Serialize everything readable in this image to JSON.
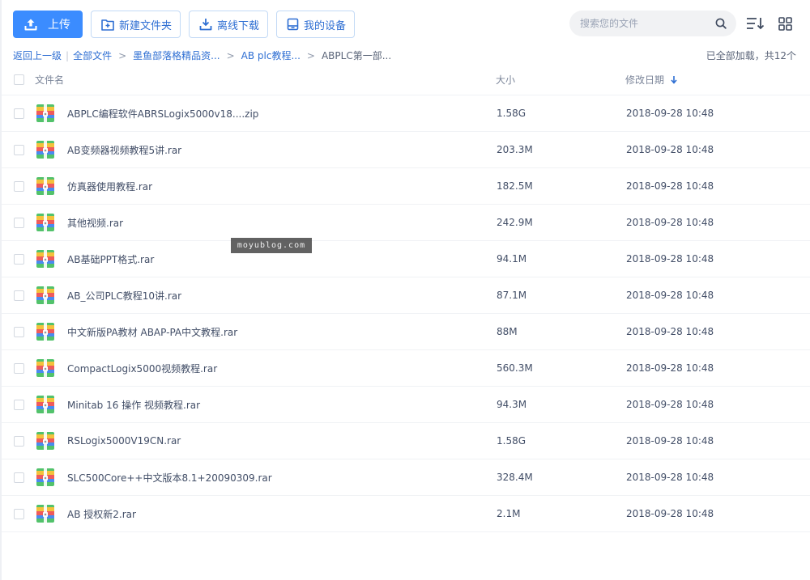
{
  "toolbar": {
    "upload_label": "上传",
    "new_folder_label": "新建文件夹",
    "offline_download_label": "离线下载",
    "my_devices_label": "我的设备"
  },
  "search": {
    "placeholder": "搜索您的文件"
  },
  "breadcrumb": {
    "back": "返回上一级",
    "all_files": "全部文件",
    "level1": "墨鱼部落格精品资...",
    "level2": "AB plc教程...",
    "current": "ABPLC第一部..."
  },
  "load_status": "已全部加载，共12个",
  "columns": {
    "name": "文件名",
    "size": "大小",
    "date": "修改日期"
  },
  "files": [
    {
      "name": "ABPLC编程软件ABRSLogix5000v18....zip",
      "size": "1.58G",
      "date": "2018-09-28 10:48"
    },
    {
      "name": "AB变频器视频教程5讲.rar",
      "size": "203.3M",
      "date": "2018-09-28 10:48"
    },
    {
      "name": "仿真器使用教程.rar",
      "size": "182.5M",
      "date": "2018-09-28 10:48"
    },
    {
      "name": "其他视频.rar",
      "size": "242.9M",
      "date": "2018-09-28 10:48"
    },
    {
      "name": "AB基础PPT格式.rar",
      "size": "94.1M",
      "date": "2018-09-28 10:48"
    },
    {
      "name": "AB_公司PLC教程10讲.rar",
      "size": "87.1M",
      "date": "2018-09-28 10:48"
    },
    {
      "name": "中文新版PA教材 ABAP-PA中文教程.rar",
      "size": "88M",
      "date": "2018-09-28 10:48"
    },
    {
      "name": "CompactLogix5000视频教程.rar",
      "size": "560.3M",
      "date": "2018-09-28 10:48"
    },
    {
      "name": "Minitab 16 操作 视频教程.rar",
      "size": "94.3M",
      "date": "2018-09-28 10:48"
    },
    {
      "name": "RSLogix5000V19CN.rar",
      "size": "1.58G",
      "date": "2018-09-28 10:48"
    },
    {
      "name": "SLC500Core++中文版本8.1+20090309.rar",
      "size": "328.4M",
      "date": "2018-09-28 10:48"
    },
    {
      "name": "AB 授权新2.rar",
      "size": "2.1M",
      "date": "2018-09-28 10:48"
    }
  ],
  "watermark": "moyublog.com",
  "icons": {
    "upload": "upload-icon",
    "new_folder": "new-folder-icon",
    "download": "download-icon",
    "device": "device-icon",
    "search": "search-icon",
    "sort": "sort-icon",
    "grid": "grid-view-icon",
    "archive": "archive-file-icon"
  },
  "colors": {
    "primary": "#3b8cff",
    "link": "#2f6fd3",
    "text": "#424e67"
  }
}
